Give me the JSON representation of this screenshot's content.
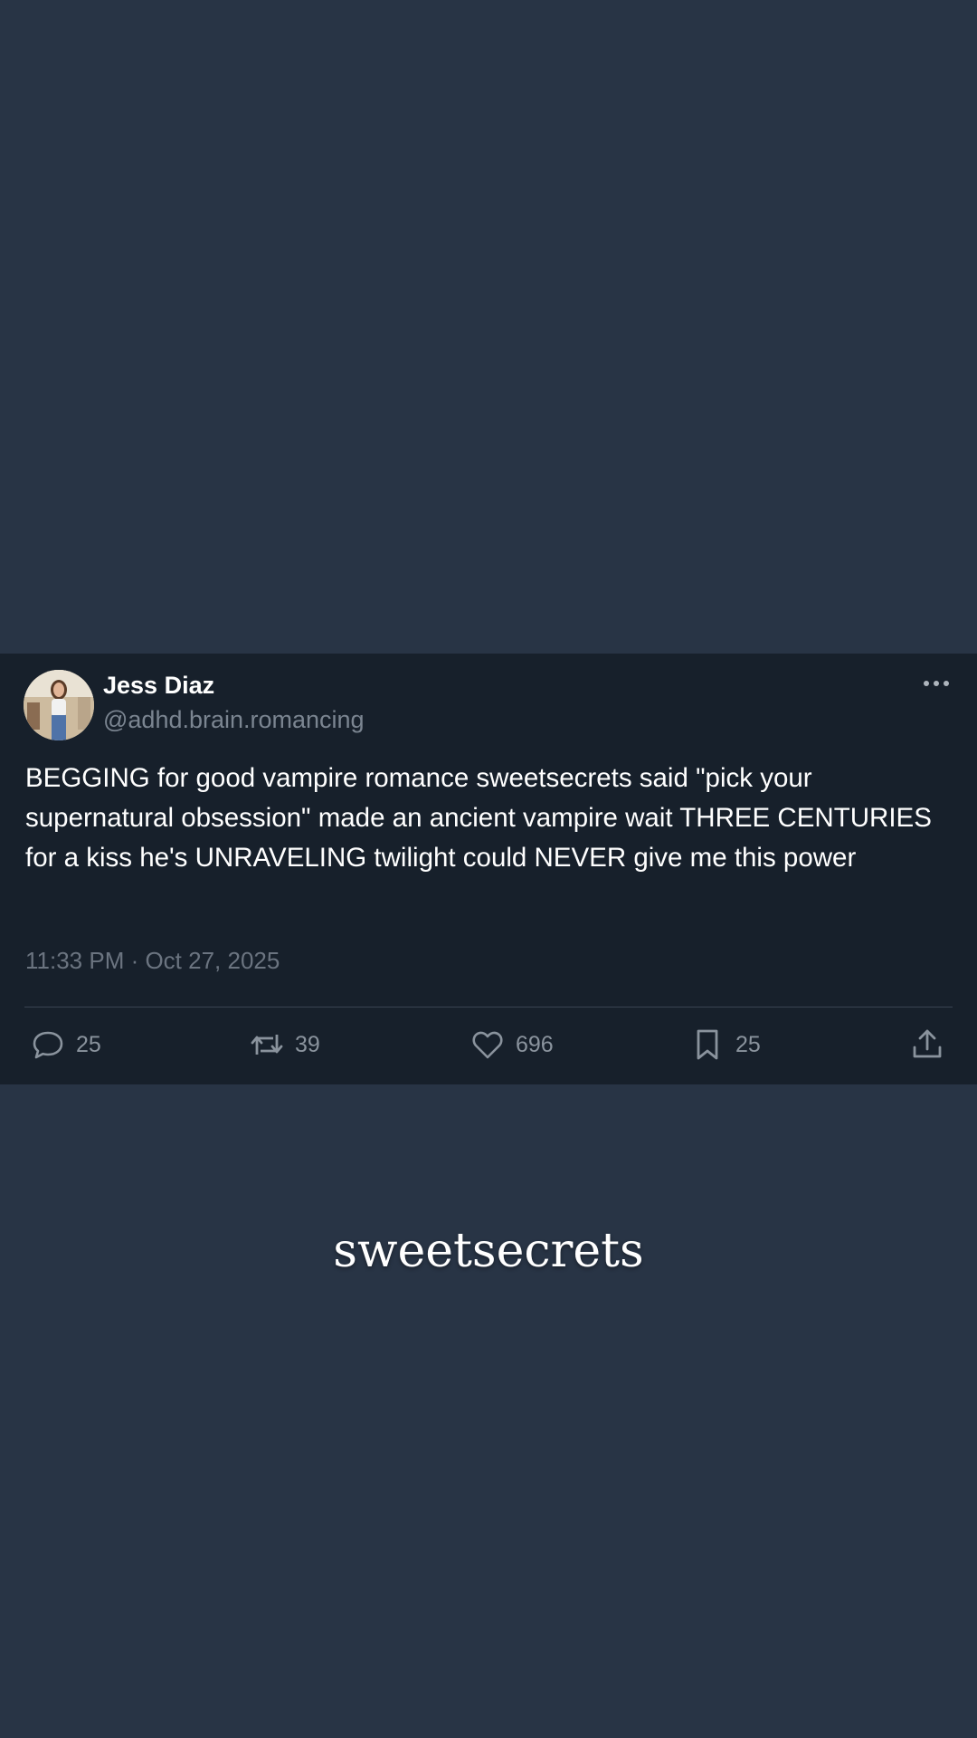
{
  "post": {
    "author_name": "Jess Diaz",
    "author_handle": "@adhd.brain.romancing",
    "text": "BEGGING for good vampire romance sweetsecrets said \"pick your supernatural obsession\" made an ancient vampire wait THREE CENTURIES for a kiss he's UNRAVELING twilight could NEVER give me this power",
    "timestamp": "11:33 PM · Oct 27, 2025",
    "actions": {
      "replies": "25",
      "reposts": "39",
      "likes": "696",
      "bookmarks": "25"
    }
  },
  "brand": {
    "wordmark": "sweetsecrets"
  },
  "colors": {
    "background": "#283445",
    "card": "#17202b",
    "text_primary": "#ffffff",
    "text_secondary": "#7b8591"
  }
}
